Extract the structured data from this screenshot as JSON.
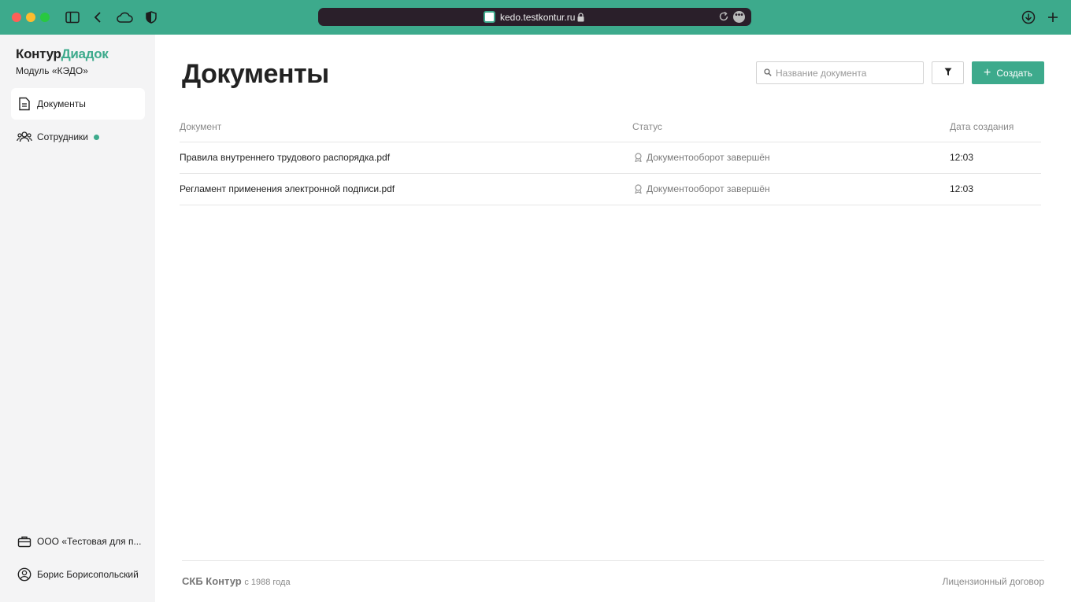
{
  "browser": {
    "url": "kedo.testkontur.ru"
  },
  "sidebar": {
    "brand_part1": "Контур",
    "brand_part2": "Диадок",
    "subtitle": "Модуль «КЭДО»",
    "items": [
      {
        "label": "Документы",
        "icon": "document-icon",
        "active": true
      },
      {
        "label": "Сотрудники",
        "icon": "people-icon",
        "active": false
      }
    ],
    "org": "ООО «Тестовая для п...",
    "user": "Борис Борисопольский"
  },
  "main": {
    "title": "Документы",
    "search_placeholder": "Название документа",
    "create_label": "Создать",
    "columns": [
      "Документ",
      "Статус",
      "Дата создания"
    ],
    "rows": [
      {
        "name": "Правила внутреннего трудового распорядка.pdf",
        "status": "Документооборот завершён",
        "date": "12:03"
      },
      {
        "name": "Регламент применения электронной подписи.pdf",
        "status": "Документооборот завершён",
        "date": "12:03"
      }
    ]
  },
  "footer": {
    "brand": "СКБ Контур",
    "since": "с 1988 года",
    "license": "Лицензионный договор"
  },
  "colors": {
    "accent": "#3daa8c",
    "sidebar_bg": "#f4f4f5",
    "address_bar": "#2a1f2a"
  }
}
